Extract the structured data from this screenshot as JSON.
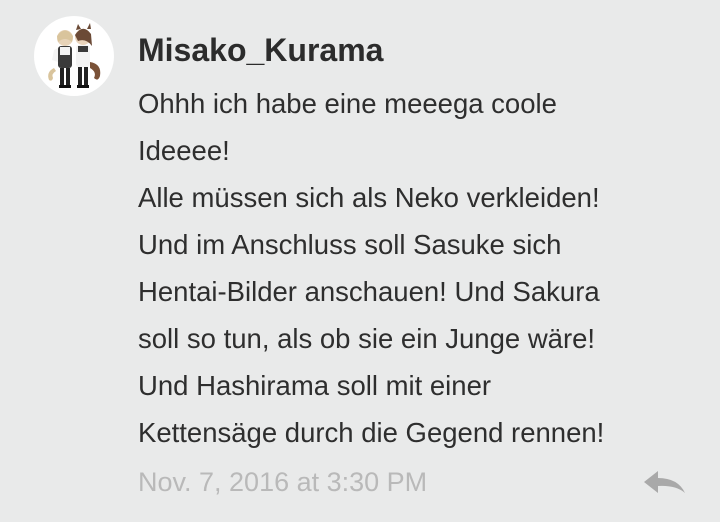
{
  "comment": {
    "username": "Misako_Kurama",
    "lines": [
      "Ohhh ich habe eine meeega coole",
      "Ideeee!",
      "Alle müssen sich als Neko verkleiden!",
      "Und im Anschluss soll Sasuke sich",
      "Hentai-Bilder anschauen! Und Sakura",
      "soll so tun, als ob sie ein Junge wäre!",
      "Und Hashirama soll mit einer",
      "Kettensäge durch die Gegend rennen!"
    ],
    "timestamp": "Nov. 7, 2016 at 3:30 PM",
    "avatar_icon": "anime-characters-avatar",
    "reply_icon": "reply-arrow-icon",
    "colors": {
      "background": "#e9eaea",
      "text": "#2e2e2e",
      "timestamp": "#b9b9b9",
      "reply_icon": "#a9a9a9"
    }
  }
}
